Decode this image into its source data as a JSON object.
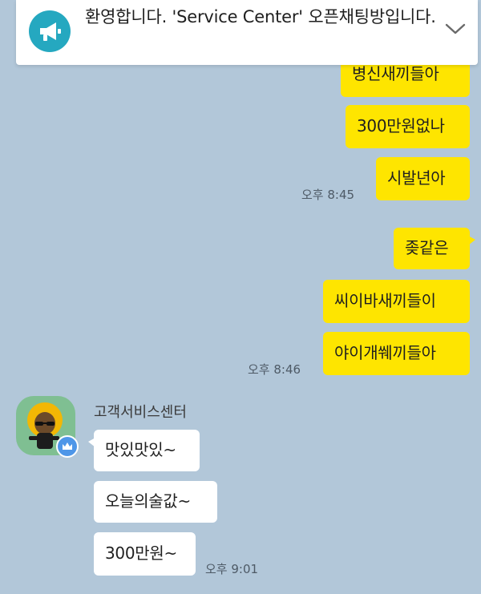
{
  "notice": {
    "text": "환영합니다. 'Service Center' 오픈채팅방입니다.",
    "icon": "megaphone-icon",
    "toggle_icon": "chevron-down-icon"
  },
  "colors": {
    "background": "#b2c7d9",
    "my_bubble": "#fee500",
    "their_bubble": "#ffffff",
    "notice_icon": "#25a8c0"
  },
  "messages": {
    "mine": [
      {
        "text": "병신새끼들아"
      },
      {
        "text": "300만원없나"
      },
      {
        "text": "시발년아"
      },
      {
        "text": "좆같은"
      },
      {
        "text": "씨이바새끼들이"
      },
      {
        "text": "야이개쒜끼들아"
      }
    ],
    "mine_times": [
      "오후 8:45",
      "오후 8:46"
    ],
    "theirs_sender": "고객서비스센터",
    "theirs": [
      {
        "text": "맛있맛있~"
      },
      {
        "text": "오늘의술값~"
      },
      {
        "text": "300만원~"
      }
    ],
    "theirs_time": "오후 9:01"
  }
}
